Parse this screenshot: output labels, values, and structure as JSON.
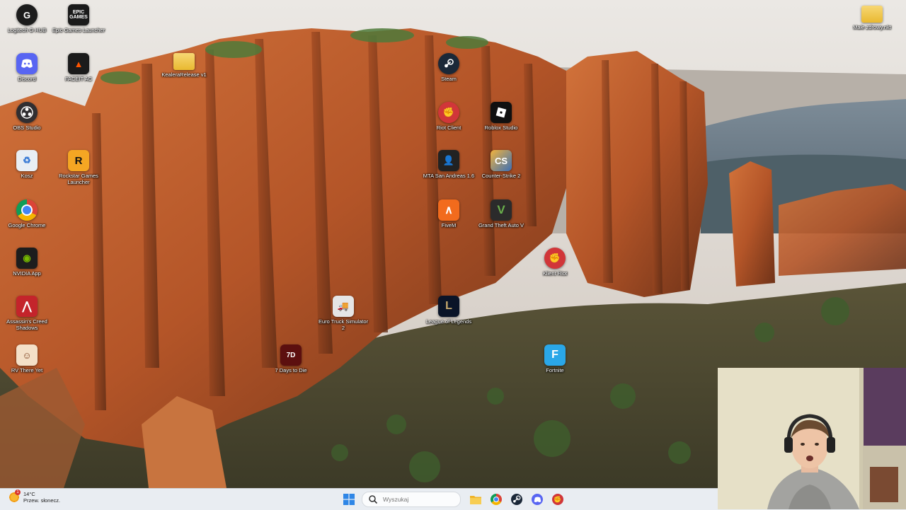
{
  "desktop": {
    "icons": [
      {
        "label": "Logitech G HUB",
        "icon": "logitech-g-icon",
        "color": "#1c1c1c"
      },
      {
        "label": "Epic Games Launcher",
        "icon": "epic-games-icon",
        "color": "#1a1a1a"
      },
      {
        "label": "Discord",
        "icon": "discord-icon",
        "color": "#5865f2"
      },
      {
        "label": "FACEIT AC",
        "icon": "faceit-icon",
        "color": "#1b1b1b"
      },
      {
        "label": "KealeraRelease v1",
        "icon": "folder-icon",
        "color": "#f2c94c"
      },
      {
        "label": "Steam",
        "icon": "steam-icon",
        "color": "#1b2838"
      },
      {
        "label": "OBS Studio",
        "icon": "obs-icon",
        "color": "#302e31"
      },
      {
        "label": "Riot Client",
        "icon": "riot-client-icon",
        "color": "#d13639"
      },
      {
        "label": "Roblox Studio",
        "icon": "roblox-studio-icon",
        "color": "#101010"
      },
      {
        "label": "Kosz",
        "icon": "recycle-bin-icon",
        "color": "#e8eef4"
      },
      {
        "label": "Rockstar Games Launcher",
        "icon": "rockstar-icon",
        "color": "#f5a623"
      },
      {
        "label": "MTA San Andreas 1.6",
        "icon": "mta-icon",
        "color": "#222222"
      },
      {
        "label": "Counter-Strike 2",
        "icon": "cs2-icon",
        "color": "#e8a33a"
      },
      {
        "label": "Google Chrome",
        "icon": "chrome-icon",
        "color": "#ffffff"
      },
      {
        "label": "FiveM",
        "icon": "fivem-icon",
        "color": "#f26b1d"
      },
      {
        "label": "Grand Theft Auto V",
        "icon": "gta5-icon",
        "color": "#2b2b2b"
      },
      {
        "label": "NVIDIA App",
        "icon": "nvidia-icon",
        "color": "#1d1d1d"
      },
      {
        "label": "Klient Riot",
        "icon": "riot-client-icon",
        "color": "#d13639"
      },
      {
        "label": "Assassin's Creed Shadows",
        "icon": "assassins-creed-icon",
        "color": "#c4242b"
      },
      {
        "label": "Euro Truck Simulator 2",
        "icon": "ets2-icon",
        "color": "#e5e5e5"
      },
      {
        "label": "League of Legends",
        "icon": "league-icon",
        "color": "#0a1428"
      },
      {
        "label": "RV There Yet",
        "icon": "rv-there-yet-icon",
        "color": "#f4e0c8"
      },
      {
        "label": "7 Days to Die",
        "icon": "seven-days-icon",
        "color": "#5c0f0f"
      },
      {
        "label": "Fortnite",
        "icon": "fortnite-icon",
        "color": "#2aa7e8"
      },
      {
        "label": "Małe zdrowy.nkt",
        "icon": "folder-icon",
        "color": "#f2c94c"
      }
    ]
  },
  "taskbar": {
    "weather": {
      "temp": "14°C",
      "condition": "Przew. słonecz.",
      "badge": "1"
    },
    "search_placeholder": "Wyszukaj",
    "pinned": [
      {
        "name": "file-explorer-icon",
        "color": "#f0b429"
      },
      {
        "name": "chrome-icon",
        "color": "#db4437"
      },
      {
        "name": "steam-icon",
        "color": "#1b2838"
      },
      {
        "name": "discord-icon",
        "color": "#5865f2"
      },
      {
        "name": "riot-client-icon",
        "color": "#d13639"
      }
    ]
  }
}
